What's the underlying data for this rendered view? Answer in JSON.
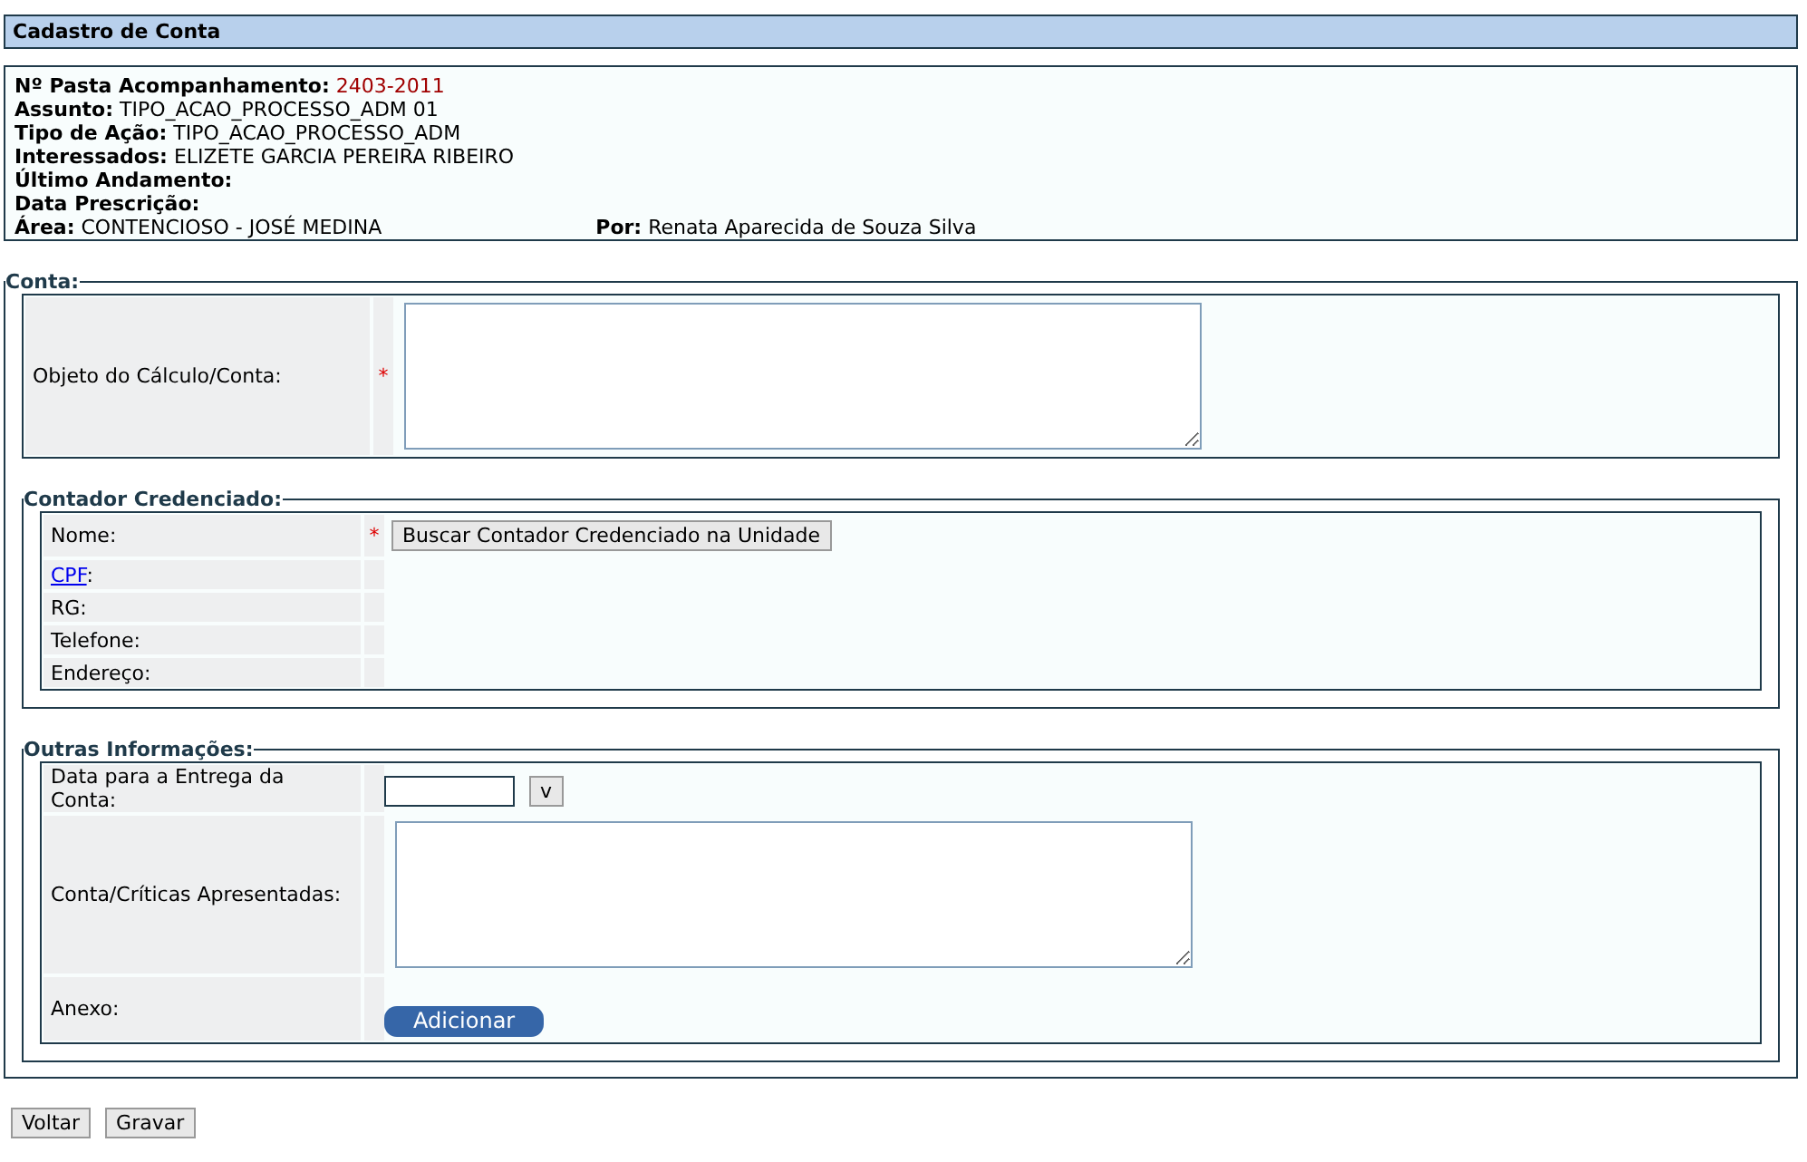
{
  "title": "Cadastro de Conta",
  "info": [
    {
      "fields": [
        {
          "label": "Nº Pasta Acompanhamento:",
          "value": "2403-2011",
          "highlight": true
        }
      ]
    },
    {
      "fields": [
        {
          "label": "Assunto:",
          "value": "TIPO_ACAO_PROCESSO_ADM 01",
          "highlight": false
        }
      ]
    },
    {
      "fields": [
        {
          "label": "Tipo de Ação:",
          "value": "TIPO_ACAO_PROCESSO_ADM",
          "highlight": false
        }
      ]
    },
    {
      "fields": [
        {
          "label": "Interessados:",
          "value": "ELIZETE GARCIA PEREIRA RIBEIRO",
          "highlight": false
        }
      ]
    },
    {
      "fields": [
        {
          "label": "Último Andamento:"
        }
      ]
    },
    {
      "fields": [
        {
          "label": "Data Prescrição:"
        }
      ]
    },
    {
      "fields": [
        {
          "label": "Área:",
          "value": "CONTENCIOSO - JOSÉ MEDINA",
          "highlight": false
        },
        {
          "label": "Por:",
          "value": "Renata Aparecida de Souza Silva",
          "highlight": false
        }
      ]
    }
  ],
  "conta": {
    "legend": "Conta:",
    "rows": [
      {
        "label": "Objeto do Cálculo/Conta:",
        "marker": "*",
        "kind": "textarea"
      }
    ],
    "sections": [
      {
        "legend": "Contador Credenciado:",
        "rows": [
          {
            "label": "Nome:",
            "marker": "*",
            "kind": "button",
            "button": "Buscar Contador Credenciado na Unidade"
          },
          {
            "link": "CPF",
            "label": ":",
            "kind": "empty"
          },
          {
            "label": "RG:",
            "kind": "empty"
          },
          {
            "label": "Telefone:",
            "kind": "empty"
          },
          {
            "label": "Endereço:",
            "kind": "empty"
          }
        ]
      },
      {
        "legend": "Outras Informações:",
        "rows": [
          {
            "label": "Data para a Entrega da Conta:",
            "kind": "date",
            "button": "v"
          },
          {
            "label": "Conta/Críticas Apresentadas:",
            "kind": "textarea"
          },
          {
            "label": "Anexo:",
            "kind": "upload",
            "button": "Adicionar"
          }
        ]
      }
    ]
  },
  "buttons": [
    "Voltar",
    "Gravar"
  ]
}
